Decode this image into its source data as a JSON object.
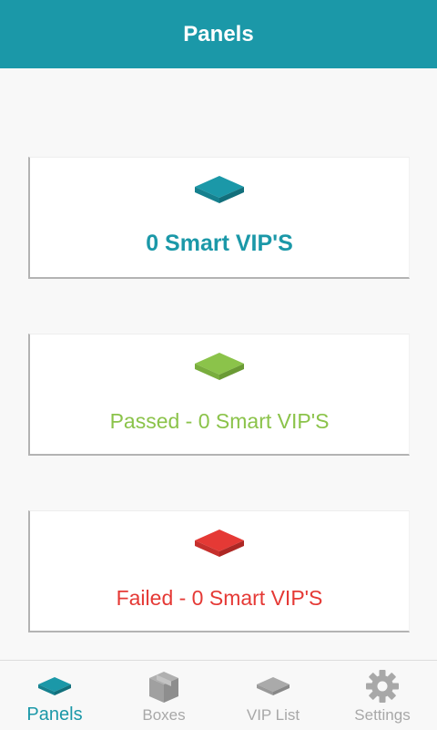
{
  "header": {
    "title": "Panels"
  },
  "cards": {
    "total": {
      "label": "0 Smart VIP'S",
      "color": "#1b98a8",
      "icon": "panel-icon"
    },
    "passed": {
      "label": "Passed - 0 Smart VIP'S",
      "color": "#8bc34a",
      "icon": "panel-icon"
    },
    "failed": {
      "label": "Failed - 0 Smart VIP'S",
      "color": "#e53935",
      "icon": "panel-icon"
    }
  },
  "tabs": [
    {
      "label": "Panels",
      "icon": "panel-icon",
      "active": true
    },
    {
      "label": "Boxes",
      "icon": "box-icon",
      "active": false
    },
    {
      "label": "VIP List",
      "icon": "panel-icon",
      "active": false
    },
    {
      "label": "Settings",
      "icon": "gear-icon",
      "active": false
    }
  ],
  "colors": {
    "accent": "#1b98a8",
    "passed": "#8bc34a",
    "failed": "#e53935",
    "inactive_tab": "#a8a8a8"
  }
}
